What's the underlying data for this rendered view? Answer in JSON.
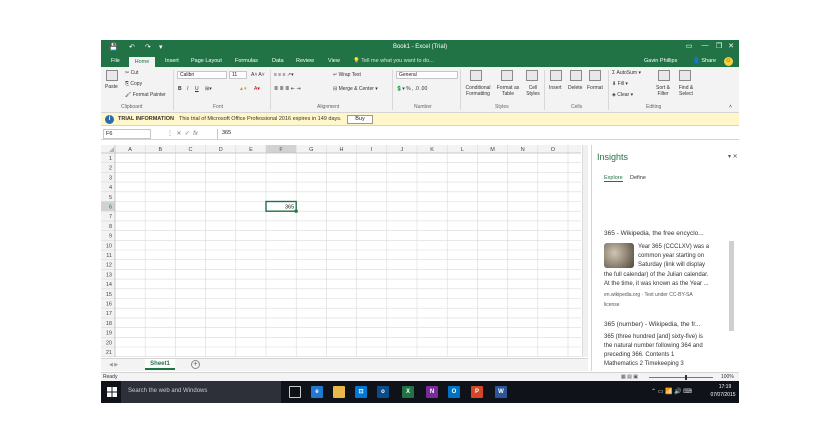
{
  "window": {
    "title": "Book1 - Excel (Trial)",
    "user": "Gavin Phillips",
    "share": "Share",
    "controls": [
      "—",
      "❐",
      "✕"
    ],
    "qat": [
      "💾",
      "↶",
      "↷",
      "▾"
    ]
  },
  "tabs": [
    "File",
    "Home",
    "Insert",
    "Page Layout",
    "Formulas",
    "Data",
    "Review",
    "View"
  ],
  "tell_me": "Tell me what you want to do...",
  "ribbon": {
    "clipboard": {
      "paste": "Paste",
      "cut": "Cut",
      "copy": "Copy",
      "format_painter": "Format Painter",
      "label": "Clipboard"
    },
    "font": {
      "name": "Calibri",
      "size": "11",
      "label": "Font"
    },
    "alignment": {
      "wrap": "Wrap Text",
      "merge": "Merge & Center",
      "label": "Alignment"
    },
    "number": {
      "format": "General",
      "label": "Number"
    },
    "styles": {
      "conditional": "Conditional Formatting",
      "format_table": "Format as Table",
      "cell_styles": "Cell Styles",
      "label": "Styles"
    },
    "cells": {
      "insert": "Insert",
      "delete": "Delete",
      "format": "Format",
      "label": "Cells"
    },
    "editing": {
      "autosum": "AutoSum",
      "fill": "Fill",
      "clear": "Clear",
      "sort": "Sort & Filter",
      "find": "Find & Select",
      "label": "Editing"
    }
  },
  "message_bar": {
    "title": "TRIAL INFORMATION",
    "text": "This trial of Microsoft Office Professional 2016 expires in 149 days.",
    "button": "Buy"
  },
  "formula_bar": {
    "name_box": "F6",
    "value": "365"
  },
  "grid": {
    "columns": [
      "A",
      "B",
      "C",
      "D",
      "E",
      "F",
      "G",
      "H",
      "I",
      "J",
      "K",
      "L",
      "M",
      "N",
      "O",
      "P"
    ],
    "rows": [
      "1",
      "2",
      "3",
      "4",
      "5",
      "6",
      "7",
      "8",
      "9",
      "10",
      "11",
      "12",
      "13",
      "14",
      "15",
      "16",
      "17",
      "18",
      "19",
      "20",
      "21"
    ],
    "selected_col": "F",
    "selected_row": "6",
    "cells": [
      {
        "col": "F",
        "row": "6",
        "value": "365"
      }
    ]
  },
  "sheets": [
    "Sheet1"
  ],
  "insights": {
    "title": "Insights",
    "tabs": [
      "Explore",
      "Define"
    ],
    "results": [
      {
        "title": "365 - Wikipedia, the free encyclo...",
        "lines": [
          "Year 365 (CCCLXV) was a",
          "common year starting on",
          "Saturday (link will display",
          "the full calendar) of the Julian calendar.",
          "At the time, it was known as the Year ..."
        ],
        "source": "en.wikipedia.org · Text under CC-BY-SA",
        "license": "license"
      },
      {
        "title": "365 (number) - Wikipedia, the fr...",
        "lines": [
          "365 (three hundred [and] sixty-five) is",
          "the natural number following 364 and",
          "preceding 366. Contents 1",
          "Mathematics 2 Timekeeping 3",
          "Religious meanings 3.1 Judeo-Christia..."
        ],
        "source": "en.wikipedia.org · Text under CC-BY-SA",
        "license": "license"
      }
    ]
  },
  "status": {
    "ready": "Ready",
    "zoom": "100%"
  },
  "taskbar": {
    "search": "Search the web and Windows",
    "time": "17:19",
    "date": "07/07/2015"
  },
  "colors": {
    "excel_green": "#217346",
    "message_bg": "#fff7c9",
    "taskbar": "#0f1319"
  }
}
